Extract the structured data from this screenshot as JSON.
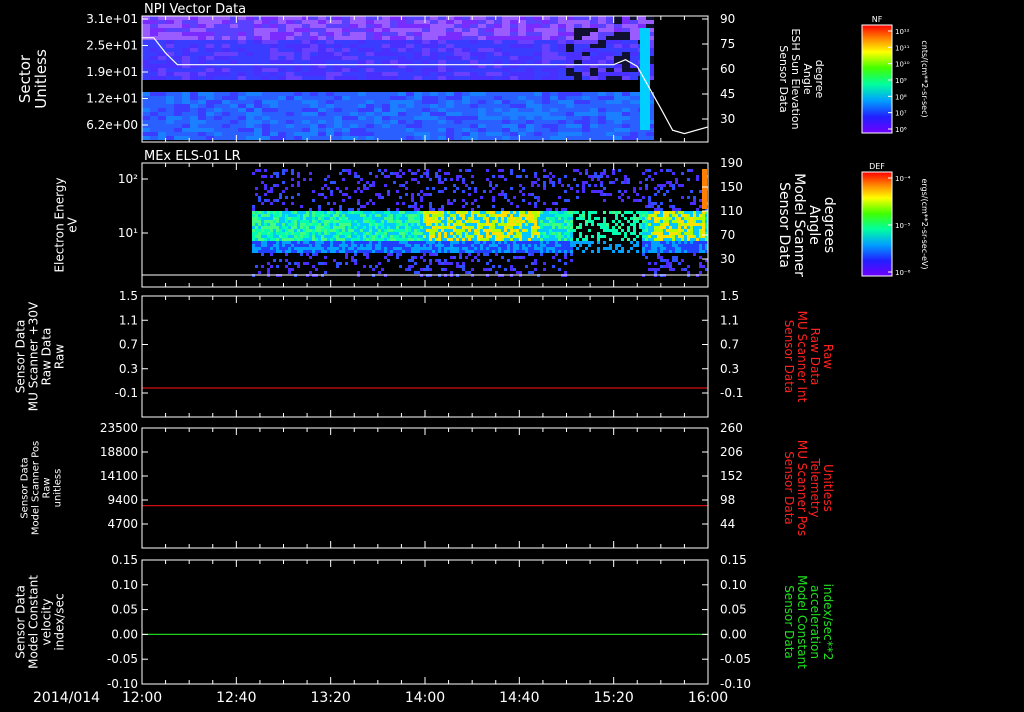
{
  "date_label": "2014/014",
  "time_ticks": [
    "12:00",
    "12:40",
    "13:20",
    "14:00",
    "14:40",
    "15:20",
    "16:00"
  ],
  "chart_data": [
    {
      "type": "heatmap",
      "title": "NPI Vector Data",
      "ylabel_left": [
        "Sector",
        "Unitless"
      ],
      "yticks_left": [
        "3.1e+01",
        "2.5e+01",
        "1.9e+01",
        "1.2e+01",
        "6.2e+00"
      ],
      "ylabel_right": [
        "Sensor Data",
        "ESH Sun Elevation",
        "Angle",
        "degree"
      ],
      "yticks_right": [
        "90",
        "75",
        "60",
        "45",
        "30"
      ],
      "ylim_right": [
        15,
        90
      ],
      "overlay_line": {
        "x": [
          "12:00",
          "12:05",
          "12:10",
          "12:15",
          "14:30",
          "15:20",
          "15:25",
          "15:30",
          "15:40",
          "15:45",
          "15:50",
          "16:00"
        ],
        "y": [
          77,
          77,
          68,
          61,
          61,
          61,
          64,
          60,
          35,
          22,
          20,
          24
        ]
      },
      "colorbar": {
        "label_top": "NF",
        "unit": "cnts/(cm**2-sr-sec)",
        "ticks": [
          "10¹²",
          "10¹¹",
          "10¹⁰",
          "10⁹",
          "10⁸",
          "10⁷",
          "10⁶"
        ]
      }
    },
    {
      "type": "heatmap",
      "title": "MEx ELS-01 LR",
      "ylabel_left": [
        "Electron Energy",
        "eV"
      ],
      "yticks_left": [
        "10²",
        "10¹"
      ],
      "ylabel_right": [
        "Sensor Data",
        "Model Scanner",
        "Angle",
        "degrees"
      ],
      "yticks_right": [
        "190",
        "150",
        "110",
        "70",
        "30"
      ],
      "ylim_right": [
        0,
        190
      ],
      "colorbar": {
        "label_top": "DEF",
        "unit": "ergs/(cm**2-sr-sec-eV)",
        "ticks": [
          "10⁻⁴",
          "10⁻⁵",
          "10⁻⁶"
        ]
      }
    },
    {
      "type": "line",
      "ylabel_left": [
        "Sensor Data",
        "MU Scanner +30V",
        "Raw Data",
        "Raw"
      ],
      "yticks_left": [
        "1.5",
        "1.1",
        "0.7",
        "0.3",
        "-0.1"
      ],
      "ylabel_right": [
        "Sensor Data",
        "MU Scanner Int",
        "Raw Data",
        "Raw"
      ],
      "yticks_right": [
        "1.5",
        "1.1",
        "0.7",
        "0.3",
        "-0.1"
      ],
      "ylim": [
        -0.5,
        1.5
      ],
      "series": [
        {
          "color": "#d01010",
          "values": [
            -0.02,
            -0.02
          ]
        }
      ]
    },
    {
      "type": "line",
      "ylabel_left": [
        "Sensor Data",
        "Model Scanner Pos",
        "Raw",
        "unitless"
      ],
      "yticks_left": [
        "23500",
        "18800",
        "14100",
        "9400",
        "4700"
      ],
      "ylabel_right": [
        "Sensor Data",
        "MU Scanner Pos",
        "Telemetry",
        "Unitless"
      ],
      "yticks_right": [
        "260",
        "206",
        "152",
        "98",
        "44"
      ],
      "ylim": [
        0,
        23500
      ],
      "series": [
        {
          "color": "#d01010",
          "values": [
            8300,
            8300
          ]
        }
      ]
    },
    {
      "type": "line",
      "ylabel_left": [
        "Sensor Data",
        "Model Constant",
        "velocity",
        "index/sec"
      ],
      "yticks_left": [
        "0.15",
        "0.10",
        "0.05",
        "0.00",
        "-0.05",
        "-0.10"
      ],
      "ylabel_right": [
        "Sensor Data",
        "Model Constant",
        "acceleration",
        "index/sec**2"
      ],
      "yticks_right": [
        "0.15",
        "0.10",
        "0.05",
        "0.00",
        "-0.05",
        "-0.10"
      ],
      "ylim": [
        -0.1,
        0.15
      ],
      "series": [
        {
          "color": "#20d020",
          "values": [
            0.0,
            0.0
          ]
        }
      ]
    }
  ],
  "colors": {
    "axis": "#ffffff",
    "right_label_panel3": "#ff2020",
    "right_label_panel4": "#ff2020",
    "right_label_panel5": "#20e020"
  }
}
